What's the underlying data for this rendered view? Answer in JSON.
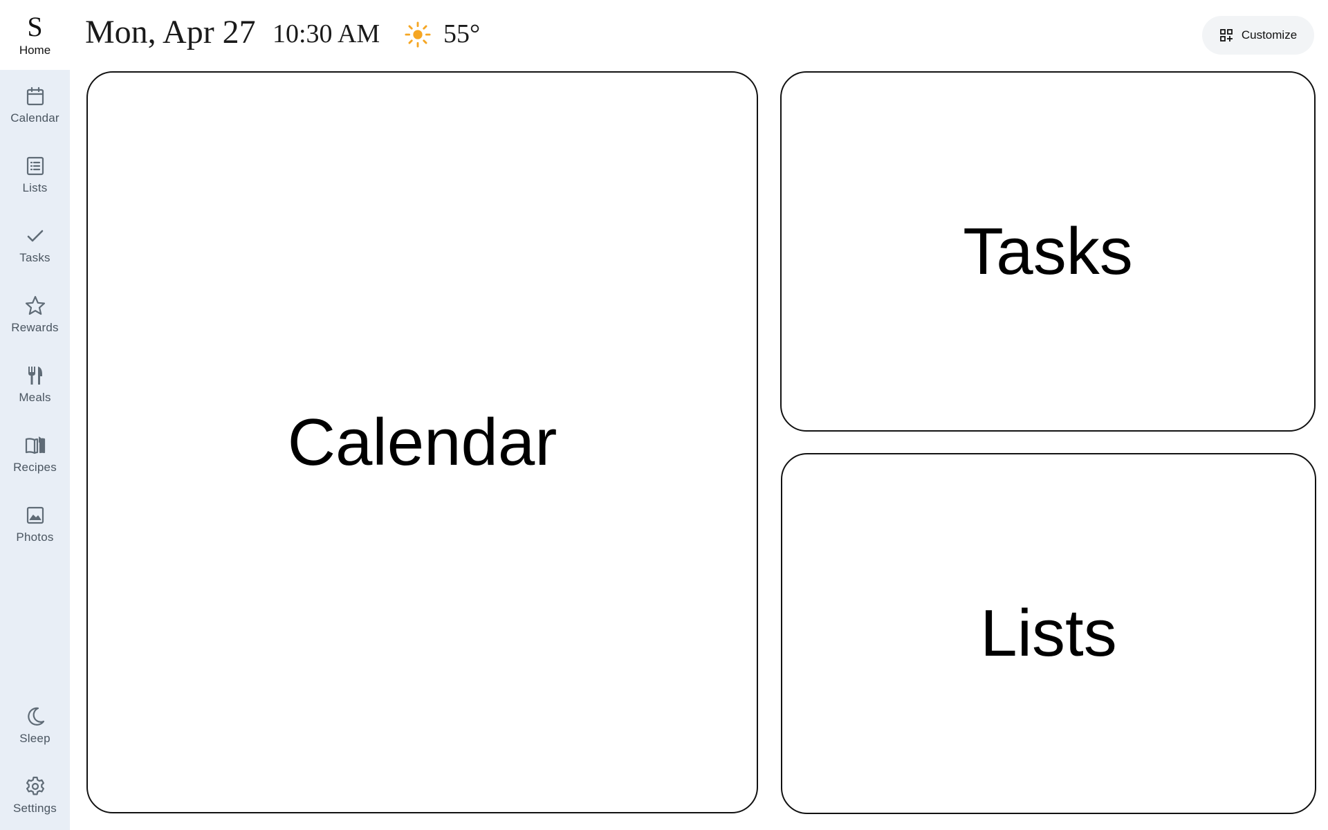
{
  "sidebar": {
    "home": {
      "logo": "S",
      "label": "Home"
    },
    "items": [
      {
        "id": "calendar",
        "label": "Calendar",
        "icon": "calendar-icon"
      },
      {
        "id": "lists",
        "label": "Lists",
        "icon": "list-icon"
      },
      {
        "id": "tasks",
        "label": "Tasks",
        "icon": "checkmark-icon"
      },
      {
        "id": "rewards",
        "label": "Rewards",
        "icon": "star-icon"
      },
      {
        "id": "meals",
        "label": "Meals",
        "icon": "fork-knife-icon"
      },
      {
        "id": "recipes",
        "label": "Recipes",
        "icon": "recipe-book-icon"
      },
      {
        "id": "photos",
        "label": "Photos",
        "icon": "photo-icon"
      }
    ],
    "bottom_items": [
      {
        "id": "sleep",
        "label": "Sleep",
        "icon": "moon-icon"
      },
      {
        "id": "settings",
        "label": "Settings",
        "icon": "gear-icon"
      }
    ]
  },
  "header": {
    "date": "Mon, Apr 27",
    "time": "10:30 AM",
    "weather_icon": "sun-icon",
    "temperature": "55°",
    "customize_label": "Customize",
    "customize_icon": "grid-add-icon"
  },
  "widgets": {
    "calendar": {
      "title": "Calendar"
    },
    "tasks": {
      "title": "Tasks"
    },
    "lists": {
      "title": "Lists"
    }
  },
  "colors": {
    "sidebar_background": "#e8eef6",
    "nav_icon": "#5f6b76",
    "sun": "#f5a623",
    "widget_border": "#111111",
    "customize_background": "#f2f4f6"
  }
}
